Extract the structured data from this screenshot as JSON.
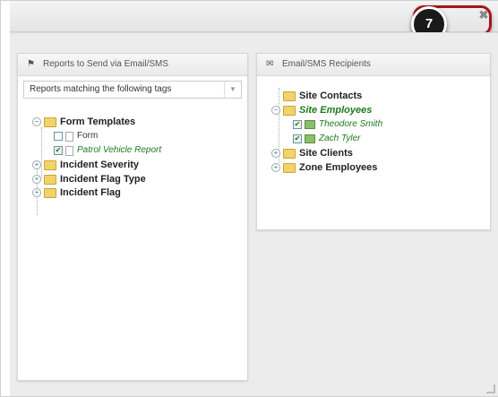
{
  "callout": {
    "step": "7"
  },
  "header": {
    "close_glyph": "✖"
  },
  "left_panel": {
    "title": "Reports to Send via Email/SMS",
    "select_value": "Reports matching the following tags",
    "tree": {
      "form_templates": {
        "label": "Form Templates"
      },
      "form": {
        "label": "Form"
      },
      "patrol_vehicle_report": {
        "label": "Patrol Vehicle Report"
      },
      "incident_severity": {
        "label": "Incident Severity"
      },
      "incident_flag_type": {
        "label": "Incident Flag Type"
      },
      "incident_flag": {
        "label": "Incident Flag"
      }
    }
  },
  "right_panel": {
    "title": "Email/SMS Recipients",
    "tree": {
      "site_contacts": {
        "label": "Site Contacts"
      },
      "site_employees": {
        "label": "Site Employees"
      },
      "theodore_smith": {
        "label": "Theodore Smith"
      },
      "zach_tyler": {
        "label": "Zach Tyler"
      },
      "site_clients": {
        "label": "Site Clients"
      },
      "zone_employees": {
        "label": "Zone Employees"
      }
    }
  },
  "colors": {
    "accent_green": "#1d7a1d",
    "callout_red": "#a4161a",
    "folder_yellow": "#f2d36b"
  },
  "icons": [
    "flag-icon",
    "envelope-icon",
    "folder-icon",
    "document-icon",
    "person-icon",
    "close-icon",
    "chevron-down-icon",
    "expand-icon",
    "collapse-icon",
    "checkbox-icon"
  ]
}
